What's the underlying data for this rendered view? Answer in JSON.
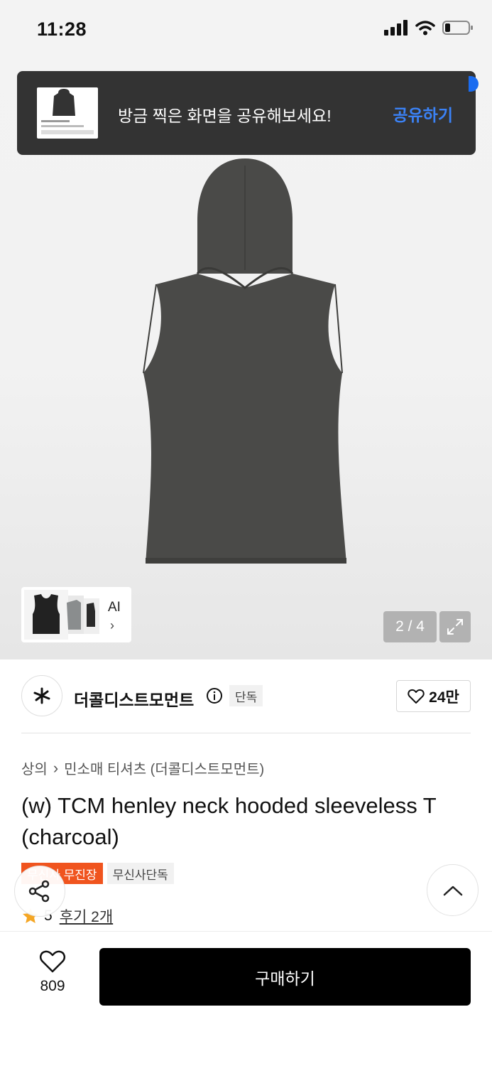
{
  "status_bar": {
    "time": "11:28"
  },
  "toast": {
    "message": "방금 찍은 화면을 공유해보세요!",
    "action": "공유하기"
  },
  "gallery": {
    "ai_label": "AI",
    "current_page": 2,
    "total_pages": 4,
    "pager_text": "2 / 4"
  },
  "brand": {
    "name": "더콜디스트모먼트",
    "badge": "단독",
    "likes": "24만"
  },
  "breadcrumb": {
    "category": "상의",
    "subcategory": "민소매 티셔츠 (더콜디스트모먼트)"
  },
  "product": {
    "title": "(w) TCM henley neck hooded sleeveless T (charcoal)",
    "tags": [
      "무신사 무진장",
      "무신사단독"
    ],
    "rating": "5",
    "review_text": "후기 2개"
  },
  "bottom_bar": {
    "wish_count": "809",
    "buy_label": "구매하기"
  },
  "colors": {
    "accent_blue": "#3b82f6",
    "tag_orange": "#f0541e",
    "toast_bg": "#333333",
    "buy_bg": "#000000",
    "star": "#f5a623"
  }
}
